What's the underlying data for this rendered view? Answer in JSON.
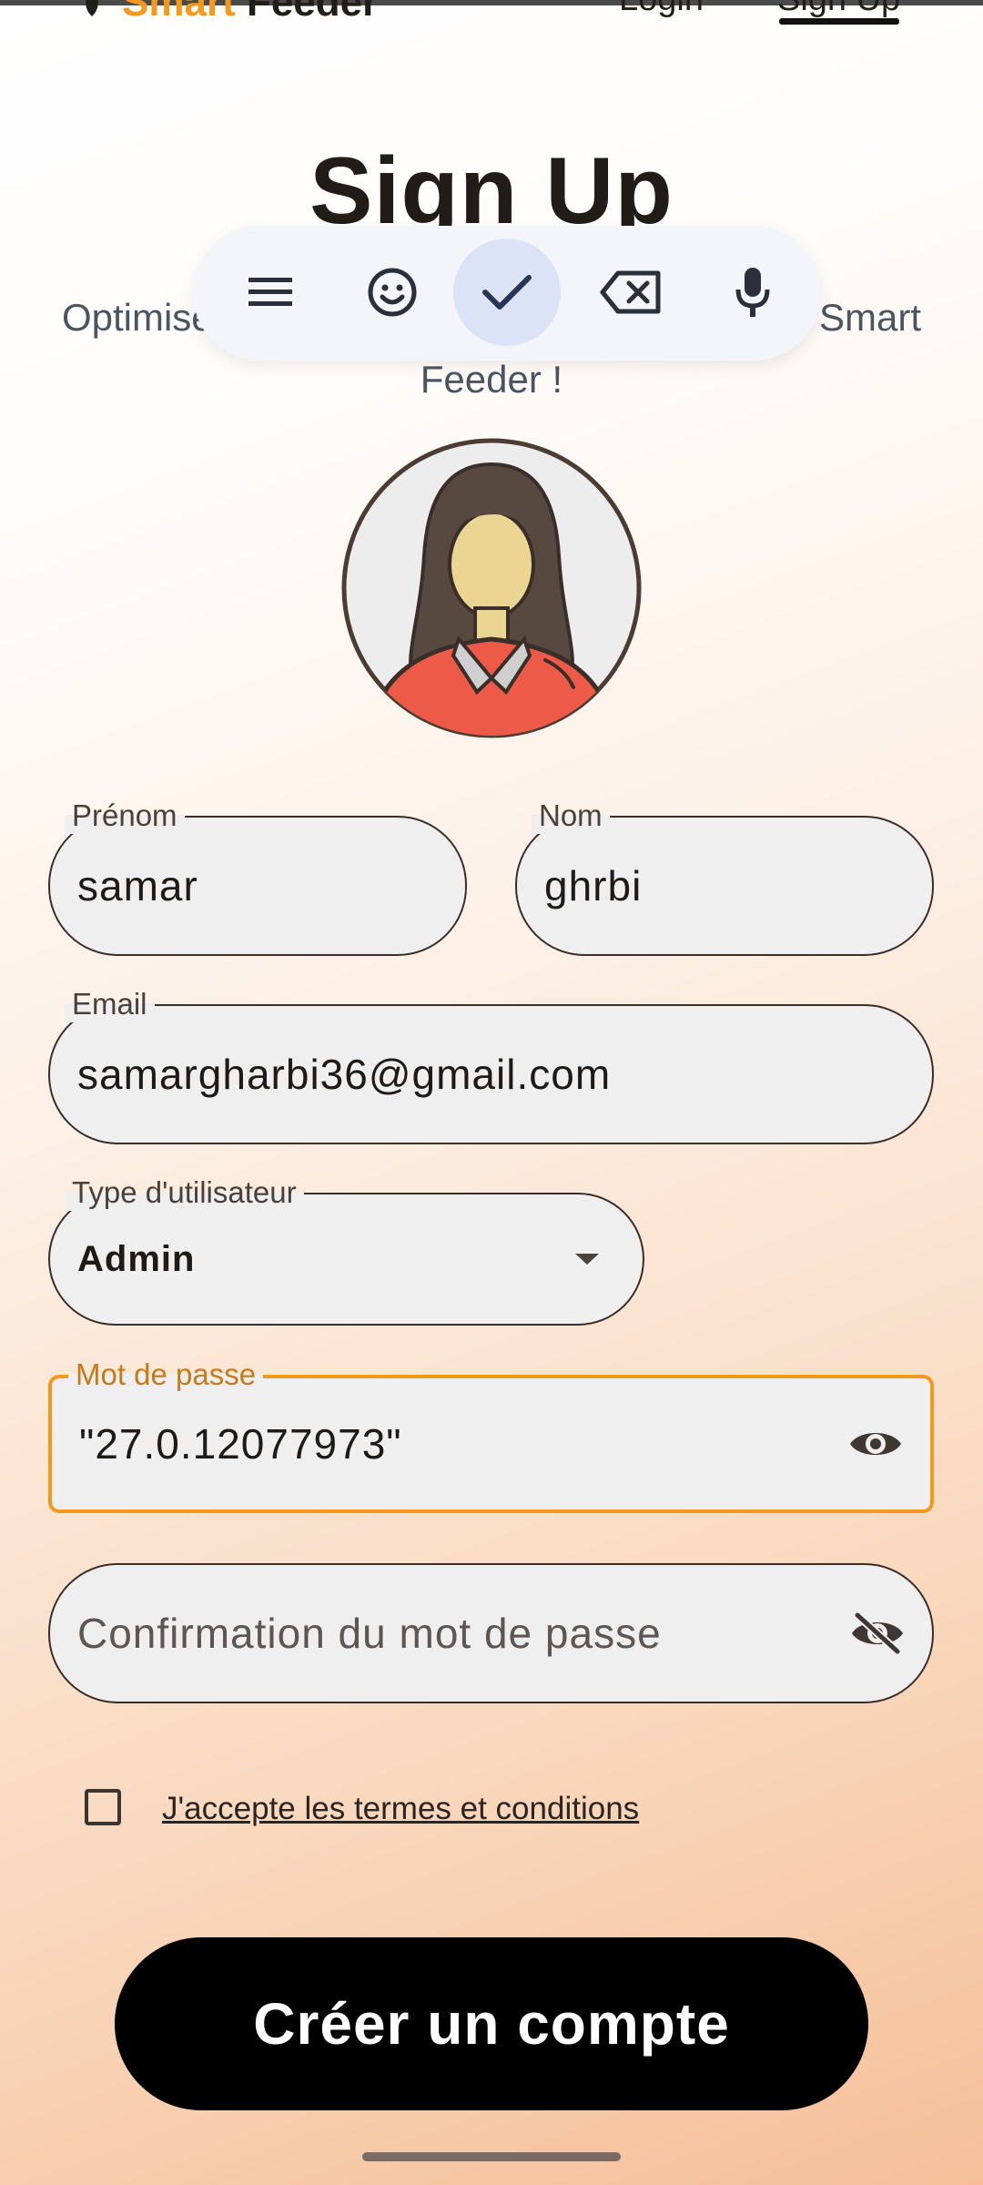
{
  "header": {
    "brand_part1": "Smart",
    "brand_part2": "Feeder",
    "nav_login": "Login",
    "nav_signup": "Sign Up",
    "brand_color": "#f39a1e"
  },
  "page": {
    "title": "Sign Up",
    "subtitle": "Optimisez l'alimentation de votre poule avec Smart Feeder !"
  },
  "keyboard_toolbar": {
    "icons": [
      "menu-icon",
      "emoji-icon",
      "check-icon",
      "backspace-icon",
      "microphone-icon"
    ]
  },
  "form": {
    "first_name": {
      "label": "Prénom",
      "value": "samar"
    },
    "last_name": {
      "label": "Nom",
      "value": "ghrbi"
    },
    "email": {
      "label": "Email",
      "value": "samargharbi36@gmail.com"
    },
    "user_type": {
      "label": "Type d'utilisateur",
      "value": "Admin"
    },
    "password": {
      "label": "Mot de passe",
      "value": "\"27.0.12077973\""
    },
    "confirm_password": {
      "placeholder": "Confirmation du mot de passe"
    },
    "terms_label": "J'accepte les termes et conditions",
    "terms_checked": false,
    "submit_label": "Créer un compte"
  }
}
